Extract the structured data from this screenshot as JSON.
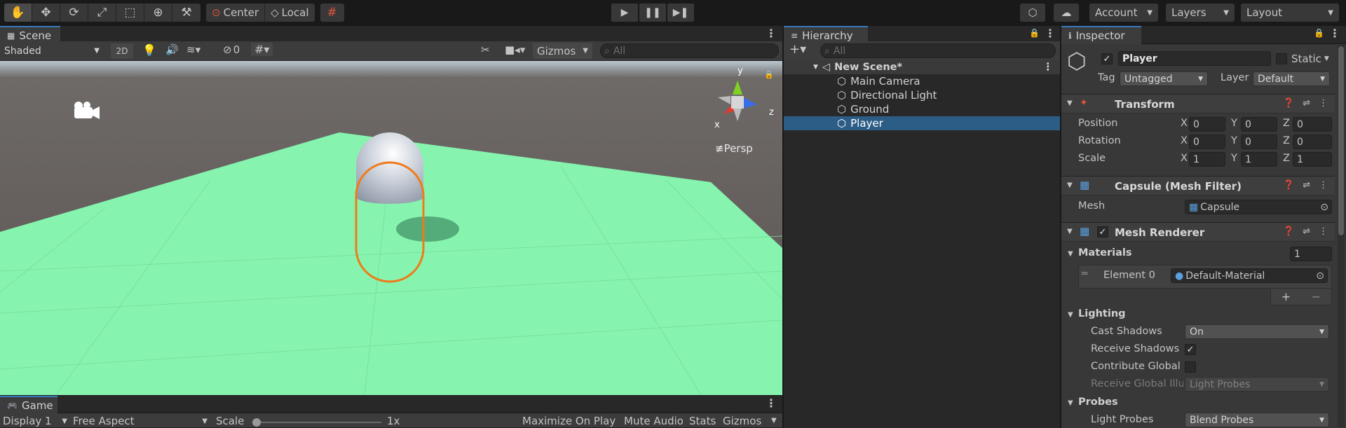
{
  "toolbar": {
    "pivot_center": "Center",
    "pivot_local": "Local",
    "account": "Account",
    "layers": "Layers",
    "layout": "Layout"
  },
  "scene": {
    "tab": "Scene",
    "shading": "Shaded",
    "mode_2d": "2D",
    "hidden_count": "0",
    "gizmos": "Gizmos",
    "search_placeholder": "All",
    "persp": "≢Persp",
    "axis_x": "x",
    "axis_y": "y",
    "axis_z": "z"
  },
  "game": {
    "tab": "Game",
    "display": "Display 1",
    "aspect": "Free Aspect",
    "scale_label": "Scale",
    "scale_value": "1x",
    "maximize": "Maximize On Play",
    "mute": "Mute Audio",
    "stats": "Stats",
    "gizmos": "Gizmos"
  },
  "hierarchy": {
    "tab": "Hierarchy",
    "search_placeholder": "All",
    "scene_name": "New Scene*",
    "items": [
      "Main Camera",
      "Directional Light",
      "Ground",
      "Player"
    ],
    "selected": "Player"
  },
  "inspector": {
    "tab": "Inspector",
    "object_name": "Player",
    "static": "Static",
    "tag_label": "Tag",
    "tag": "Untagged",
    "layer_label": "Layer",
    "layer": "Default",
    "transform": {
      "title": "Transform",
      "position_label": "Position",
      "rotation_label": "Rotation",
      "scale_label": "Scale",
      "position": [
        "0",
        "0",
        "0"
      ],
      "rotation": [
        "0",
        "0",
        "0"
      ],
      "scale": [
        "1",
        "1",
        "1"
      ],
      "x": "X",
      "y": "Y",
      "z": "Z"
    },
    "mesh_filter": {
      "title": "Capsule (Mesh Filter)",
      "mesh_label": "Mesh",
      "mesh": "Capsule"
    },
    "mesh_renderer": {
      "title": "Mesh Renderer",
      "materials_label": "Materials",
      "materials_count": "1",
      "element_label": "Element 0",
      "element_value": "Default-Material",
      "add": "+",
      "remove": "−",
      "lighting_label": "Lighting",
      "cast_shadows_label": "Cast Shadows",
      "cast_shadows": "On",
      "receive_shadows_label": "Receive Shadows",
      "contribute_gi_label": "Contribute Global",
      "receive_gi_label": "Receive Global Illu",
      "receive_gi": "Light Probes",
      "probes_label": "Probes",
      "light_probes_label": "Light Probes",
      "light_probes": "Blend Probes"
    }
  },
  "colors": {
    "ground": "#8af5b0",
    "sky": "#5b5553",
    "selection_outline": "#f07a1a",
    "selected_row": "#2c5d87",
    "accent_tab": "#3a79bb"
  }
}
